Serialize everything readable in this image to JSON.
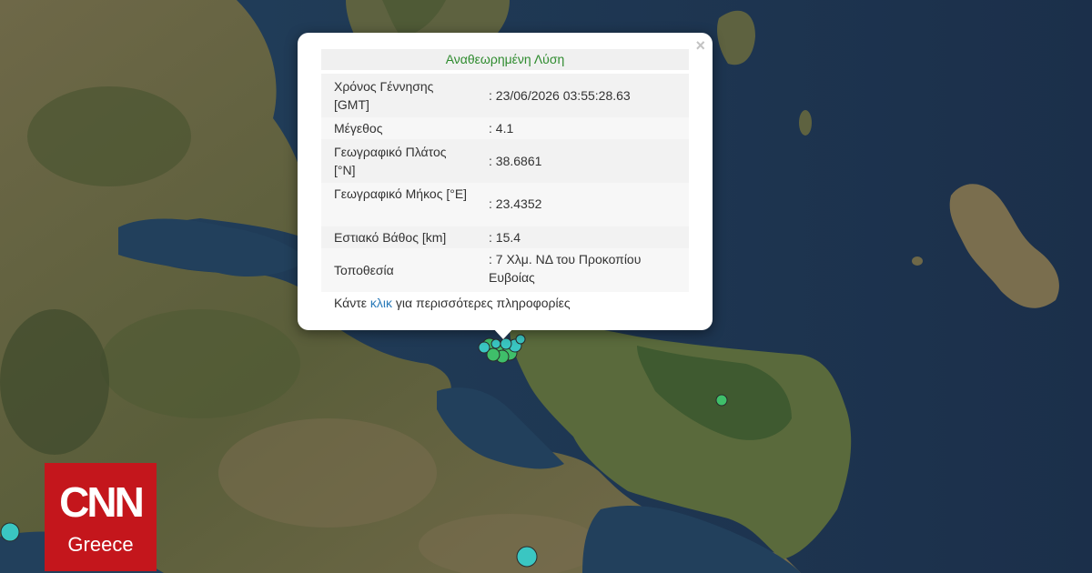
{
  "popup": {
    "title": "Αναθεωρημένη Λύση",
    "close_label": "×",
    "rows": [
      {
        "key": "Χρόνος Γέννησης [GMT]",
        "value": ": 23/06/2026 03:55:28.63"
      },
      {
        "key": "Μέγεθος",
        "value": ": 4.1"
      },
      {
        "key": "Γεωγραφικό Πλάτος [°N]",
        "value": ": 38.6861"
      },
      {
        "key": "Γεωγραφικό Μήκος [°E]",
        "value": ": 23.4352"
      },
      {
        "key": "Εστιακό Βάθος [km]",
        "value": ": 15.4"
      },
      {
        "key": "Τοποθεσία",
        "value": ": 7 Χλμ. ΝΔ του Προκοπίου Ευβοίας"
      }
    ],
    "more_prefix": "Κάντε ",
    "more_link": "κλικ",
    "more_suffix": " για περισσότερες πληροφορίες"
  },
  "logo": {
    "brand": "CNN",
    "region": "Greece",
    "color": "#c4161c"
  },
  "colors": {
    "sea": "#1e3450",
    "land": "#6b6a45",
    "quake_marker": "#3ac6c2",
    "quake_green": "#3fbf6a"
  }
}
